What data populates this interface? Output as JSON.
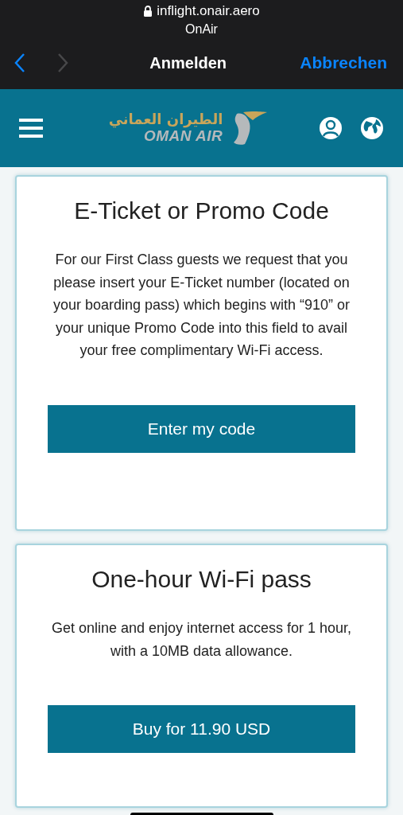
{
  "browser": {
    "url": "inflight.onair.aero",
    "site": "OnAir",
    "back": {
      "disabled": false
    },
    "forward": {
      "disabled": true
    },
    "title": "Anmelden",
    "cancel": "Abbrechen"
  },
  "header": {
    "logo_arabic": "الطيران العماني",
    "logo_latin": "OMAN AIR"
  },
  "cards": [
    {
      "title": "E-Ticket or Promo Code",
      "text": "For our First Class guests we request that you please insert your E-Ticket number (located on your boarding pass) which begins with “910” or your unique Promo Code into this field to avail your free complimentary Wi-Fi access.",
      "button": "Enter my code"
    },
    {
      "title": "One-hour Wi-Fi pass",
      "text": "Get online and enjoy internet access for 1 hour, with a 10MB data allowance.",
      "button": "Buy for 11.90 USD"
    }
  ]
}
